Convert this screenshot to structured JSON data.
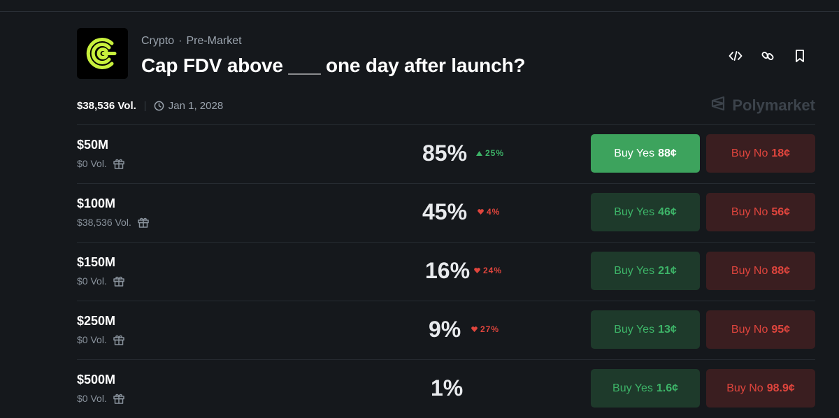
{
  "header": {
    "category": "Crypto",
    "subcategory": "Pre-Market",
    "title": "Cap FDV above ___ one day after launch?",
    "volume": "$38,536 Vol.",
    "end_date": "Jan 1, 2028",
    "brand": "Polymarket",
    "action_icons": [
      "embed-code-icon",
      "link-icon",
      "bookmark-icon"
    ]
  },
  "colors": {
    "green": "#3db468",
    "green_active": "#3da35d",
    "red": "#e0453d",
    "background": "#15181c"
  },
  "outcomes": [
    {
      "label": "$50M",
      "volume": "$0 Vol.",
      "probability": "85%",
      "change": "25%",
      "direction": "up",
      "yes": "Buy Yes",
      "yes_price": "88¢",
      "no": "Buy No",
      "no_price": "18¢"
    },
    {
      "label": "$100M",
      "volume": "$38,536 Vol.",
      "probability": "45%",
      "change": "4%",
      "direction": "down",
      "yes": "Buy Yes",
      "yes_price": "46¢",
      "no": "Buy No",
      "no_price": "56¢"
    },
    {
      "label": "$150M",
      "volume": "$0 Vol.",
      "probability": "16%",
      "change": "24%",
      "direction": "down",
      "yes": "Buy Yes",
      "yes_price": "21¢",
      "no": "Buy No",
      "no_price": "88¢"
    },
    {
      "label": "$250M",
      "volume": "$0 Vol.",
      "probability": "9%",
      "change": "27%",
      "direction": "down",
      "yes": "Buy Yes",
      "yes_price": "13¢",
      "no": "Buy No",
      "no_price": "95¢"
    },
    {
      "label": "$500M",
      "volume": "$0 Vol.",
      "probability": "1%",
      "change": "",
      "direction": "",
      "yes": "Buy Yes",
      "yes_price": "1.6¢",
      "no": "Buy No",
      "no_price": "98.9¢"
    }
  ]
}
